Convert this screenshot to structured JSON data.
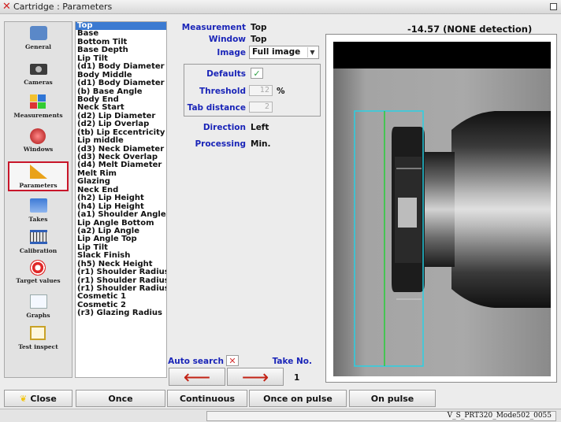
{
  "window": {
    "title": "Cartridge : Parameters"
  },
  "nav": [
    {
      "label": "General",
      "icon": "general-icon"
    },
    {
      "label": "Cameras",
      "icon": "camera-icon"
    },
    {
      "label": "Measurements",
      "icon": "measurements-icon"
    },
    {
      "label": "Windows",
      "icon": "windows-icon"
    },
    {
      "label": "Parameters",
      "icon": "parameters-icon",
      "active": true
    },
    {
      "label": "Takes",
      "icon": "takes-icon"
    },
    {
      "label": "Calibration",
      "icon": "calibration-icon"
    },
    {
      "label": "Target values",
      "icon": "target-icon"
    },
    {
      "label": "Graphs",
      "icon": "graphs-icon"
    },
    {
      "label": "Test inspect",
      "icon": "test-inspect-icon"
    }
  ],
  "measurements": [
    "Top",
    "Base",
    "Bottom Tilt",
    "Base Depth",
    "Lip Tilt",
    "(d1) Body Diameter",
    "Body Middle",
    "(d1) Body Diameter",
    "(b) Base Angle",
    "Body End",
    "Neck Start",
    "(d2) Lip Diameter",
    "(d2) Lip Overlap",
    "(tb) Lip Eccentricity",
    "Lip middle",
    "(d3) Neck Diameter",
    "(d3) Neck Overlap",
    "(d4) Melt Diameter",
    "Melt Rim",
    "Glazing",
    "Neck End",
    "(h2) Lip Height",
    "(h4) Lip Height",
    "(a1) Shoulder Angle",
    "Lip Angle Bottom",
    "(a2) Lip Angle",
    "Lip Angle Top",
    "Lip Tilt",
    "Slack Finish",
    "(h5) Neck Height",
    "(r1) Shoulder Radius",
    "(r1) Shoulder Radius",
    "(r1) Shoulder Radius",
    "Cosmetic 1",
    "Cosmetic 2",
    "(r3) Glazing Radius"
  ],
  "selected_index": 0,
  "panel": {
    "measurement_label": "Measurement",
    "measurement_value": "Top",
    "window_label": "Window",
    "window_value": "Top",
    "image_label": "Image",
    "image_value": "Full image",
    "defaults_label": "Defaults",
    "defaults_checked": true,
    "threshold_label": "Threshold",
    "threshold_value": "12",
    "threshold_unit": "%",
    "tab_label": "Tab distance",
    "tab_value": "2",
    "direction_label": "Direction",
    "direction_value": "Left",
    "processing_label": "Processing",
    "processing_value": "Min.",
    "auto_search_label": "Auto search",
    "auto_search_checked": false,
    "take_label": "Take No.",
    "take_value": "1",
    "prev_arrow": "⟵",
    "next_arrow": "⟶"
  },
  "image_header": "-14.57   (NONE detection)",
  "buttons": {
    "close": "Close",
    "once": "Once",
    "continuous": "Continuous",
    "once_on_pulse": "Once on pulse",
    "on_pulse": "On pulse"
  },
  "status": "V_S_PRT320_Mode502_0055",
  "colors": {
    "label_blue": "#1a25b8",
    "selection": "#3b7ad1",
    "accent_red": "#c8162a",
    "roi_cyan": "#22d4e8",
    "edge_green": "#2ecc40"
  }
}
